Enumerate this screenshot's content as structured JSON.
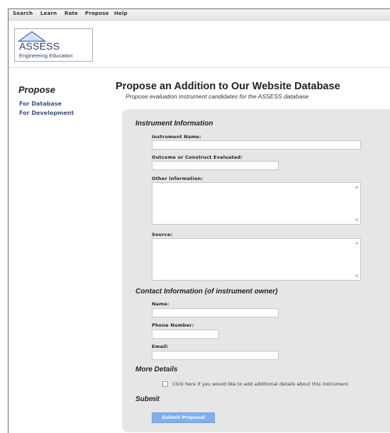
{
  "nav": {
    "items": [
      {
        "label": "Search"
      },
      {
        "label": "Learn"
      },
      {
        "label": "Rate"
      },
      {
        "label": "Propose"
      },
      {
        "label": "Help"
      }
    ]
  },
  "logo": {
    "title": "ASSESS",
    "subtitle": "Engineering Education"
  },
  "sidebar": {
    "title": "Propose",
    "links": [
      {
        "label": "For Database"
      },
      {
        "label": "For Development"
      }
    ]
  },
  "main": {
    "title": "Propose an Addition to Our Website Database",
    "subtitle": "Propose evaluation instrument candidates for the ASSESS database"
  },
  "form": {
    "sections": {
      "instrument": "Instrument Information",
      "contact": "Contact Information (of instrument owner)",
      "more": "More Details",
      "submit": "Submit"
    },
    "fields": {
      "instrument_name": {
        "label": "Instrument Name:",
        "value": ""
      },
      "outcome": {
        "label": "Outcome or Construct Evaluated:",
        "value": ""
      },
      "other_info": {
        "label": "Other information:",
        "value": ""
      },
      "source": {
        "label": "Source:",
        "value": ""
      },
      "name": {
        "label": "Name:",
        "value": ""
      },
      "phone": {
        "label": "Phone Number:",
        "value": ""
      },
      "email": {
        "label": "Email:",
        "value": ""
      }
    },
    "checkbox_label": "Click here if you would like to add additional details about this instrument",
    "checkbox_checked": false,
    "submit_label": "Submit Proposal"
  },
  "colors": {
    "link": "#3e4f8a",
    "panel": "#e6e6e6",
    "button": "#7fb0f0"
  }
}
